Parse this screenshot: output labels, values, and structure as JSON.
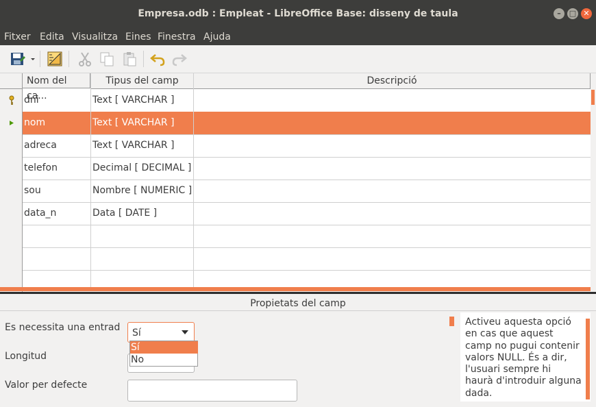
{
  "window": {
    "title": "Empresa.odb : Empleat - LibreOffice Base: disseny de taula",
    "min_icon": "minimize-icon",
    "max_icon": "maximize-icon",
    "close_icon": "close-icon"
  },
  "menu": [
    "Fitxer",
    "Edita",
    "Visualitza",
    "Eines",
    "Finestra",
    "Ajuda"
  ],
  "toolbar": {
    "icons": [
      "save-icon",
      "dropdown-arrow-icon",
      "design-ruler-icon",
      "cut-icon",
      "copy-icon",
      "paste-icon",
      "undo-icon",
      "redo-icon"
    ]
  },
  "grid": {
    "columns": [
      "Nom del ca...",
      "Tipus del camp",
      "Descripció"
    ],
    "rows": [
      {
        "name": "dni",
        "type": "Text [ VARCHAR ]",
        "desc": "",
        "marker": "key-icon"
      },
      {
        "name": "nom",
        "type": "Text [ VARCHAR ]",
        "desc": "",
        "marker": "current-row-arrow-icon"
      },
      {
        "name": "adreca",
        "type": "Text [ VARCHAR ]",
        "desc": "",
        "marker": ""
      },
      {
        "name": "telefon",
        "type": "Decimal [ DECIMAL ]",
        "desc": "",
        "marker": ""
      },
      {
        "name": "sou",
        "type": "Nombre [ NUMERIC ]",
        "desc": "",
        "marker": ""
      },
      {
        "name": "data_n",
        "type": "Data [ DATE ]",
        "desc": "",
        "marker": ""
      },
      {
        "name": "",
        "type": "",
        "desc": "",
        "marker": ""
      },
      {
        "name": "",
        "type": "",
        "desc": "",
        "marker": ""
      },
      {
        "name": "",
        "type": "",
        "desc": "",
        "marker": ""
      }
    ],
    "selected_row": 1
  },
  "properties": {
    "title": "Propietats del camp",
    "required_label": "Es necessita una entrad",
    "required_value": "Sí",
    "required_options": [
      "Sí",
      "No"
    ],
    "length_label": "Longitud",
    "default_label": "Valor per defecte",
    "help_text": "Activeu aquesta opció en cas que aquest camp no pugui contenir valors NULL. És a dir, l'usuari sempre hi haurà d'introduir alguna dada."
  },
  "colors": {
    "accent": "#f07e4c",
    "titlebar": "#3d3d3b"
  }
}
